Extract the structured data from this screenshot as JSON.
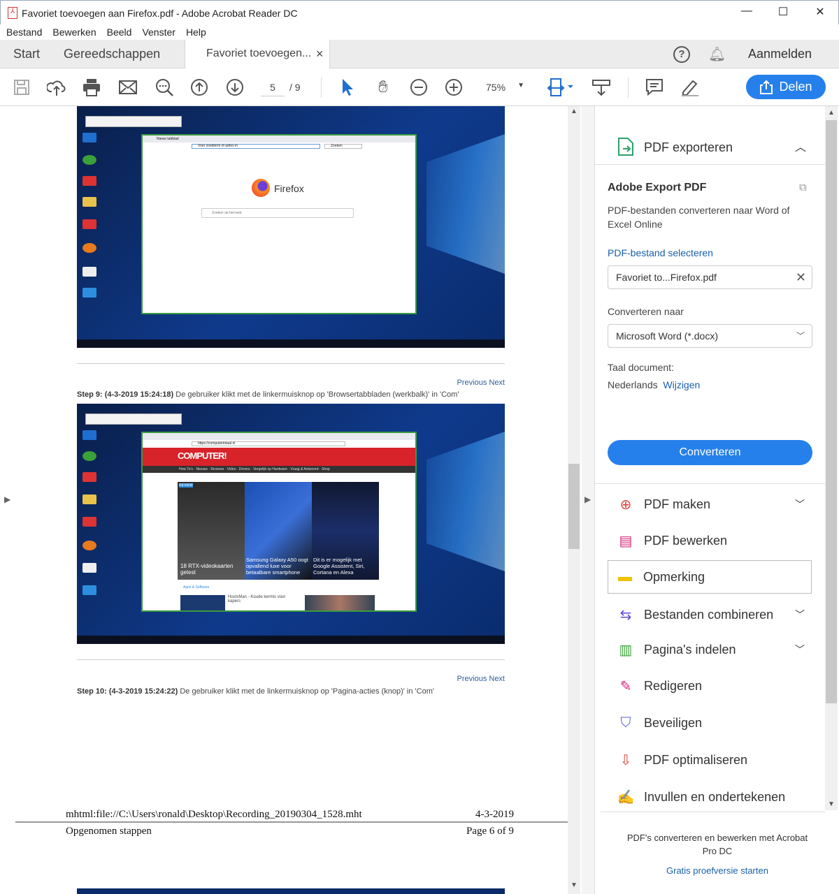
{
  "window": {
    "title": "Favoriet toevoegen aan Firefox.pdf - Adobe Acrobat Reader DC",
    "minimize": "—",
    "maximize": "☐",
    "close": "✕"
  },
  "menu": [
    "Bestand",
    "Bewerken",
    "Beeld",
    "Venster",
    "Help"
  ],
  "tabs": {
    "start": "Start",
    "tools": "Gereedschappen",
    "doc": "Favoriet toevoegen...",
    "doc_close": "×",
    "signin": "Aanmelden"
  },
  "toolbar": {
    "page_current": "5",
    "page_total": "/ 9",
    "zoom": "75%",
    "share": "Delen"
  },
  "document": {
    "shot1": {
      "browser_tab": "Nieuw tabblad",
      "address": "Voer zoekterm of adres in",
      "search": "Zoeken",
      "brand": "Firefox",
      "search_web": "Zoeken op het web"
    },
    "nav1": "Previous Next",
    "step9": {
      "label": "Step 9: (4-3-2019 15:24:18)",
      "text": " De gebruiker klikt met de linkermuisknop op 'Browsertabbladen (werkbalk)' in 'Com'"
    },
    "shot2": {
      "address": "https://computertotaal.nl",
      "logo": "COMPUTER!",
      "nav": "How To's · Nieuws · Reviews · Video · Drivers · Vergelijk op Hardware · Vraag & Antwoord · Shop",
      "card1": "18 RTX-videokaarten getest",
      "card2": "Samsung Galaxy A50 oogt opvallend luxe voor betaalbare smartphone",
      "card3": "Dit is er mogelijk met Google Assistent, Siri, Cortana en Alexa",
      "card0_tag": "REVIEW",
      "section": "Apps & Software",
      "review": "HostsMan - Koude kermis voor kapers"
    },
    "nav2": "Previous Next",
    "step10": {
      "label": "Step 10: (4-3-2019 15:24:22)",
      "text": " De gebruiker klikt met de linkermuisknop op 'Pagina-acties (knop)' in 'Com'"
    },
    "footer": {
      "path": "mhtml:file://C:\\Users\\ronald\\Desktop\\Recording_20190304_1528.mht",
      "date": "4-3-2019",
      "title": "Opgenomen stappen",
      "page": "Page 6 of 9"
    }
  },
  "panel": {
    "export_header": "PDF exporteren",
    "export_title": "Adobe Export PDF",
    "export_desc": "PDF-bestanden converteren naar Word of Excel Online",
    "select_file": "PDF-bestand selecteren",
    "file_value": "Favoriet to...Firefox.pdf",
    "convert_to_label": "Converteren naar",
    "convert_to_value": "Microsoft Word (*.docx)",
    "lang_label": "Taal document:",
    "lang_value": "Nederlands",
    "lang_change": "Wijzigen",
    "convert_button": "Converteren",
    "tools": [
      {
        "label": "PDF maken",
        "color": "#e0443e"
      },
      {
        "label": "PDF bewerken",
        "color": "#d4267a"
      },
      {
        "label": "Opmerking",
        "color": "#f2c200"
      },
      {
        "label": "Bestanden combineren",
        "color": "#5c4bd6"
      },
      {
        "label": "Pagina's indelen",
        "color": "#3aa13a"
      },
      {
        "label": "Redigeren",
        "color": "#d4267a"
      },
      {
        "label": "Beveiligen",
        "color": "#5c5fc8"
      },
      {
        "label": "PDF optimaliseren",
        "color": "#e0443e"
      },
      {
        "label": "Invullen en ondertekenen",
        "color": "#8a4bd6"
      }
    ],
    "promo": "PDF's converteren en bewerken met Acrobat Pro DC",
    "trial": "Gratis proefversie starten"
  },
  "colors": {
    "accent": "#2680eb",
    "link": "#1a5fa8"
  }
}
